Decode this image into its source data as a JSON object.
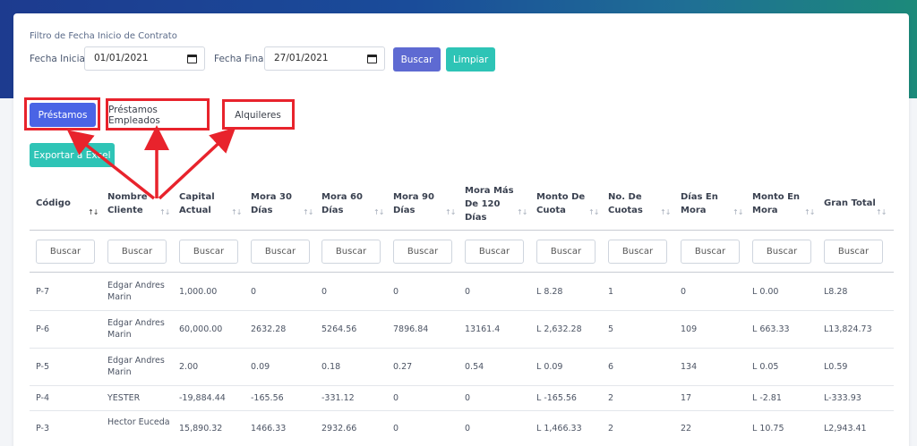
{
  "filter": {
    "title": "Filtro de Fecha Inicio de Contrato",
    "start_label": "Fecha Inicial",
    "start_value": "01/01/2021",
    "end_label": "Fecha Final",
    "end_value": "27/01/2021",
    "search_button": "Buscar",
    "clear_button": "Limpiar"
  },
  "tabs": [
    {
      "label": "Préstamos",
      "active": true
    },
    {
      "label": "Préstamos Empleados",
      "active": false
    },
    {
      "label": "Alquileres",
      "active": false
    }
  ],
  "export_button": "Exportar a Excel",
  "table": {
    "search_placeholder": "Buscar",
    "columns": [
      "Código",
      "Nombre Cliente",
      "Capital Actual",
      "Mora 30 Días",
      "Mora 60 Días",
      "Mora 90 Días",
      "Mora Más De 120 Días",
      "Monto De Cuota",
      "No. De Cuotas",
      "Días En Mora",
      "Monto En Mora",
      "Gran Total"
    ],
    "rows": [
      [
        "P-7",
        "Edgar Andres Marin",
        "1,000.00",
        "0",
        "0",
        "0",
        "0",
        "L 8.28",
        "1",
        "0",
        "L 0.00",
        "L8.28"
      ],
      [
        "P-6",
        "Edgar Andres Marin",
        "60,000.00",
        "2632.28",
        "5264.56",
        "7896.84",
        "13161.4",
        "L 2,632.28",
        "5",
        "109",
        "L 663.33",
        "L13,824.73"
      ],
      [
        "P-5",
        "Edgar Andres Marin",
        "2.00",
        "0.09",
        "0.18",
        "0.27",
        "0.54",
        "L 0.09",
        "6",
        "134",
        "L 0.05",
        "L0.59"
      ],
      [
        "P-4",
        "YESTER",
        "-19,884.44",
        "-165.56",
        "-331.12",
        "0",
        "0",
        "L -165.56",
        "2",
        "17",
        "L -2.81",
        "L-333.93"
      ],
      [
        "P-3",
        "Hector Euceda",
        "15,890.32",
        "1466.33",
        "2932.66",
        "0",
        "0",
        "L 1,466.33",
        "2",
        "22",
        "L 10.75",
        "L2,943.41"
      ]
    ]
  },
  "colors": {
    "banner_start": "#1d3b8f",
    "banner_end": "#1c8a7a",
    "primary_button": "#5e6ad2",
    "teal_button": "#2ec4b6",
    "active_tab": "#4a64e5",
    "annotation_red": "#e8232c"
  }
}
